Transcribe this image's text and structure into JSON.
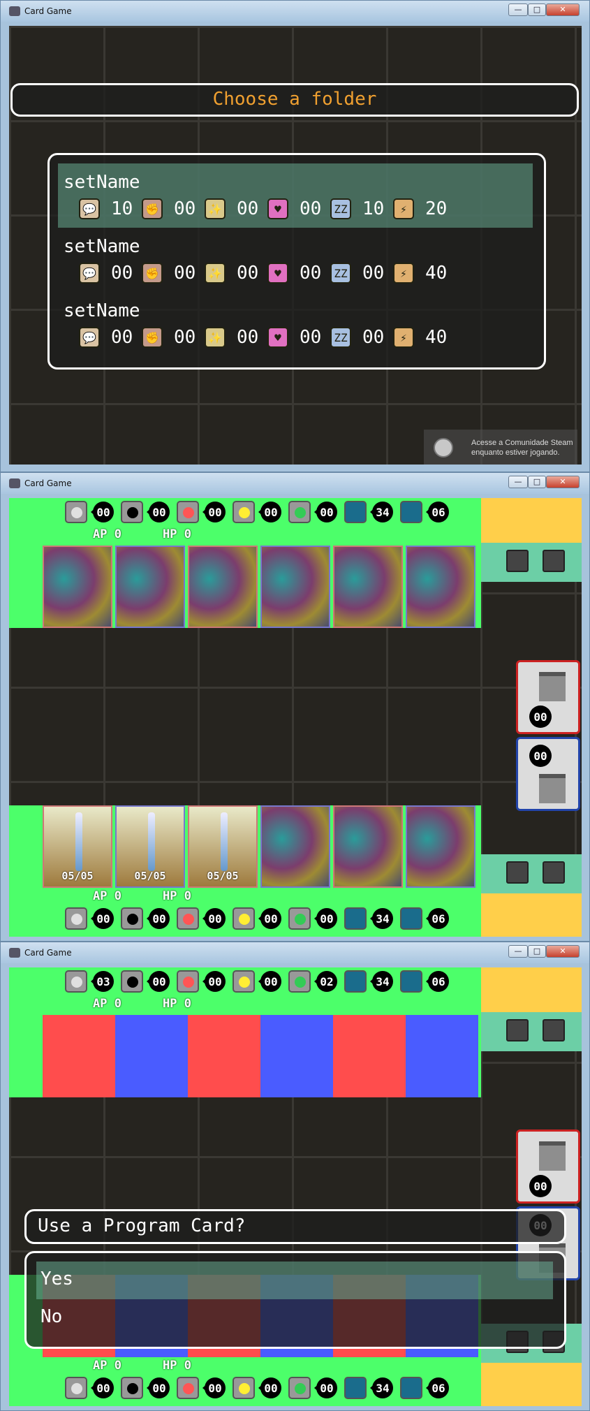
{
  "window_title": "Card Game",
  "win_buttons": {
    "min": "—",
    "max": "□",
    "close": "✕"
  },
  "s1": {
    "title": "Choose a folder",
    "folders": [
      {
        "name": "setName",
        "values": [
          "10",
          "00",
          "00",
          "00",
          "10",
          "20"
        ],
        "selected": true
      },
      {
        "name": "setName",
        "values": [
          "00",
          "00",
          "00",
          "00",
          "00",
          "40"
        ],
        "selected": false
      },
      {
        "name": "setName",
        "values": [
          "00",
          "00",
          "00",
          "00",
          "00",
          "40"
        ],
        "selected": false
      }
    ],
    "element_icons": [
      "speech-icon",
      "claw-icon",
      "star-swirl-icon",
      "heart-icon",
      "sleep-icon",
      "lightning-icon"
    ],
    "element_glyphs": [
      "💬",
      "✊",
      "✨",
      "♥",
      "ZZ",
      "⚡"
    ],
    "element_colors": [
      "#d9c3a3",
      "#c49a8a",
      "#d9c98a",
      "#e070c0",
      "#a8c0e0",
      "#e0b070"
    ],
    "steam_text": [
      "Acesse a Comunidade Steam",
      "enquanto estiver jogando."
    ]
  },
  "s2": {
    "top_counts": [
      "00",
      "00",
      "00",
      "00",
      "00",
      "34",
      "06"
    ],
    "bottom_counts": [
      "00",
      "00",
      "00",
      "00",
      "00",
      "34",
      "06"
    ],
    "ap_label": "AP 0",
    "hp_label": "HP 0",
    "sword_label": "05/05",
    "trash_counts": [
      "00",
      "00"
    ]
  },
  "s3": {
    "top_counts": [
      "03",
      "00",
      "00",
      "00",
      "02",
      "34",
      "06"
    ],
    "bottom_counts": [
      "00",
      "00",
      "00",
      "00",
      "00",
      "34",
      "06"
    ],
    "ap_label": "AP 0",
    "hp_label": "HP 0",
    "trash_counts": [
      "00",
      "00"
    ],
    "prompt": "Use a Program Card?",
    "options": [
      "Yes",
      "No"
    ]
  },
  "orb_colors": [
    "#e0e0e0",
    "#000000",
    "#ff5555",
    "#ffee33",
    "#33cc55"
  ],
  "colors": {
    "field_green": "#4cff6a",
    "yellow": "#ffcf4a",
    "teal": "#6ccfa6",
    "red_card": "#ff4d4d",
    "blue_card": "#4a5cff",
    "orange_title": "#f0a030"
  }
}
